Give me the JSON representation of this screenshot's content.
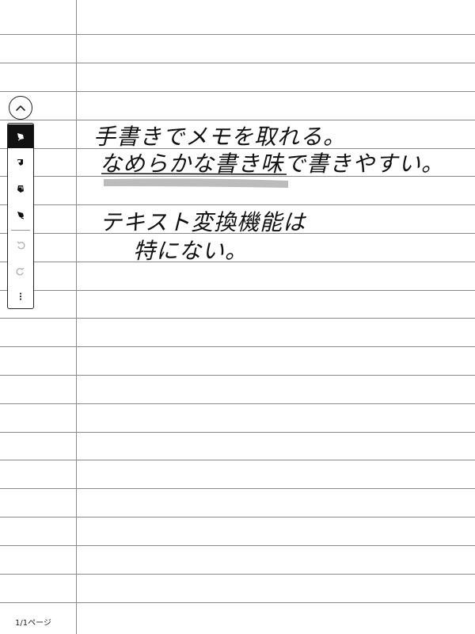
{
  "note": {
    "lines": [
      "手書きでメモを取れる。",
      "なめらかな書き味で書きやすい。",
      "テキスト変換機能は",
      "特にない。"
    ],
    "highlight_color": "#b5b5b5",
    "ink_color": "#111111",
    "rule_color": "#8a8a8a"
  },
  "toolbar": {
    "collapse_icon": "chevron-up-icon",
    "tools": [
      {
        "icon": "pen-icon",
        "active": true
      },
      {
        "icon": "highlighter-icon",
        "active": false
      },
      {
        "icon": "eraser-icon",
        "active": false
      },
      {
        "icon": "lasso-icon",
        "active": false
      },
      {
        "icon": "undo-icon",
        "active": false
      },
      {
        "icon": "redo-icon",
        "active": false
      },
      {
        "icon": "more-icon",
        "active": false
      }
    ]
  },
  "footer": {
    "page_indicator": "1/1ページ"
  }
}
